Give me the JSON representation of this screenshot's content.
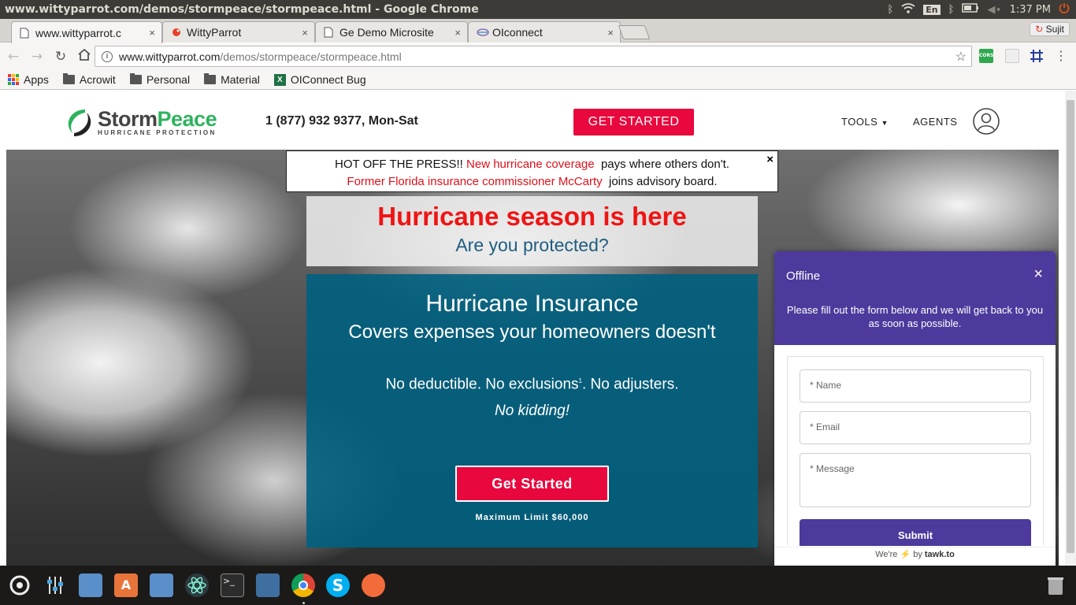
{
  "window": {
    "title": "www.wittyparrot.com/demos/stormpeace/stormpeace.html - Google Chrome",
    "keyboard_layout": "En",
    "clock": "1:37 PM"
  },
  "tabs": [
    {
      "label": "www.wittyparrot.c",
      "active": true
    },
    {
      "label": "WittyParrot",
      "active": false
    },
    {
      "label": "Ge Demo Microsite",
      "active": false
    },
    {
      "label": "OIconnect",
      "active": false
    }
  ],
  "tab_close": "×",
  "profile": {
    "name": "Sujit"
  },
  "address_bar": {
    "host": "www.wittyparrot.com",
    "path": "/demos/stormpeace/stormpeace.html"
  },
  "extensions": {
    "cors": "CORS"
  },
  "bookmarks": [
    {
      "label": "Apps",
      "icon": "apps-grid-icon"
    },
    {
      "label": "Acrowit",
      "icon": "folder-icon"
    },
    {
      "label": "Personal",
      "icon": "folder-icon"
    },
    {
      "label": "Material",
      "icon": "folder-icon"
    },
    {
      "label": "OIConnect Bug",
      "icon": "excel-icon"
    }
  ],
  "site": {
    "logo": {
      "word1": "Storm",
      "word2": "Peace",
      "tagline": "HURRICANE PROTECTION"
    },
    "phone": "1 (877) 932 9377, Mon-Sat",
    "get_started_top": "GET STARTED",
    "nav": {
      "tools": "TOOLS",
      "agents": "AGENTS"
    },
    "press": {
      "lead": "HOT OFF THE PRESS!!",
      "link1": "New hurricane coverage",
      "text1": "pays where others don't.",
      "link2": "Former Florida insurance commissioner McCarty",
      "text2": "joins advisory board.",
      "close": "×"
    },
    "season": {
      "headline": "Hurricane season is here",
      "subhead": "Are you protected?"
    },
    "insurance": {
      "title": "Hurricane Insurance",
      "subtitle": "Covers expenses your homeowners doesn't",
      "features_a": "No deductible. No exclusions",
      "footnote": "1",
      "features_b": ". No adjusters.",
      "tagline": "No kidding!",
      "cta": "Get Started",
      "limit": "Maximum Limit $60,000"
    }
  },
  "chat_widget": {
    "status": "Offline",
    "close": "×",
    "message": "Please fill out the form below and we will get back to you as soon as possible.",
    "fields": {
      "name": "* Name",
      "email": "* Email",
      "message": "* Message"
    },
    "submit": "Submit",
    "footer_pre": "We're",
    "footer_by": "by",
    "footer_brand": "tawk.to"
  },
  "colors": {
    "accent_red": "#e8083d",
    "teal": "#006080",
    "tawk_purple": "#4d3a9c",
    "logo_green": "#2fb35e"
  }
}
